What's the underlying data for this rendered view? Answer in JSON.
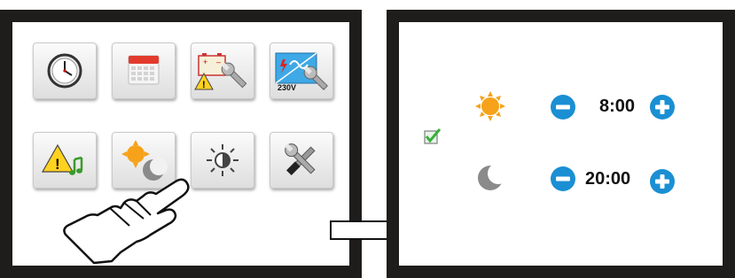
{
  "menu": {
    "tiles": [
      {
        "icon": "clock-icon"
      },
      {
        "icon": "calendar-icon"
      },
      {
        "icon": "battery-warning-settings-icon",
        "sublabel": ""
      },
      {
        "icon": "inverter-230v-settings-icon",
        "sublabel": "230V"
      },
      {
        "icon": "warning-sound-icon"
      },
      {
        "icon": "day-night-icon"
      },
      {
        "icon": "brightness-icon"
      },
      {
        "icon": "tools-icon"
      }
    ]
  },
  "schedule": {
    "enabled": true,
    "day": {
      "icon": "sun-icon",
      "time": "8:00"
    },
    "night": {
      "icon": "moon-icon",
      "time": "20:00"
    }
  },
  "colors": {
    "frame": "#1f1c1c",
    "button_blue": "#1a8fd3",
    "sun": "#f6a21a",
    "moon": "#8a8a8a",
    "check": "#3ab03a"
  }
}
